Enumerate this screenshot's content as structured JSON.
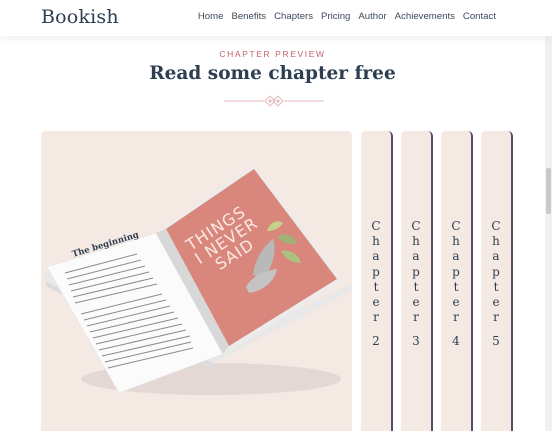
{
  "header": {
    "brand": "Bookish",
    "nav": [
      "Home",
      "Benefits",
      "Chapters",
      "Pricing",
      "Author",
      "Achievements",
      "Contact"
    ]
  },
  "section": {
    "eyebrow": "CHAPTER PREVIEW",
    "title": "Read some chapter free"
  },
  "book": {
    "chapter_heading": "The beginning",
    "cover_title_lines": [
      "THINGS",
      "I NEVER",
      "SAID"
    ]
  },
  "chapters": [
    {
      "word": "Chapter",
      "letters": [
        "C",
        "h",
        "a",
        "p",
        "t",
        "e",
        "r"
      ],
      "number": "2"
    },
    {
      "word": "Chapter",
      "letters": [
        "C",
        "h",
        "a",
        "p",
        "t",
        "e",
        "r"
      ],
      "number": "3"
    },
    {
      "word": "Chapter",
      "letters": [
        "C",
        "h",
        "a",
        "p",
        "t",
        "e",
        "r"
      ],
      "number": "4"
    },
    {
      "word": "Chapter",
      "letters": [
        "C",
        "h",
        "a",
        "p",
        "t",
        "e",
        "r"
      ],
      "number": "5"
    }
  ],
  "colors": {
    "accent": "#c0626a",
    "heading": "#2c3e50",
    "card_bg": "#f5e9e3",
    "tab_border": "#5b4a6a",
    "cover": "#d9877c"
  },
  "icons": {
    "divider": "diamond-ornament-icon"
  }
}
